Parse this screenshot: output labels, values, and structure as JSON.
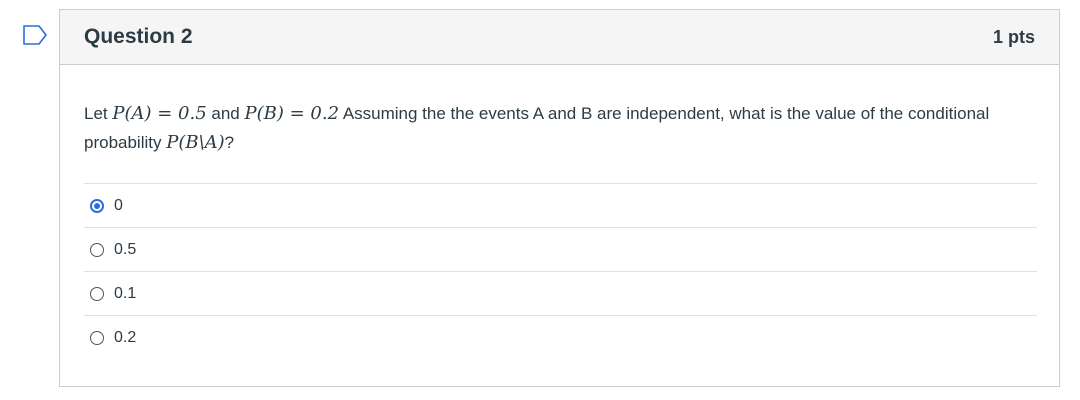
{
  "question": {
    "title": "Question 2",
    "points": "1 pts",
    "text_parts": {
      "p1": "Let ",
      "math1": "P(A) = 0.5",
      "p2": " and ",
      "math2": "P(B) = 0.2",
      "p3": " Assuming the the events A and B are independent, what is the value of the conditional probability ",
      "math3": "P(B\\A)",
      "p4": "?"
    }
  },
  "answers": [
    {
      "label": "0",
      "selected": true
    },
    {
      "label": "0.5",
      "selected": false
    },
    {
      "label": "0.1",
      "selected": false
    },
    {
      "label": "0.2",
      "selected": false
    }
  ],
  "colors": {
    "accent": "#2b6de0",
    "header_bg": "#f5f5f5",
    "border": "#c7cdd1",
    "text": "#2d3b45"
  },
  "icons": {
    "flag": "flag-question-icon"
  }
}
